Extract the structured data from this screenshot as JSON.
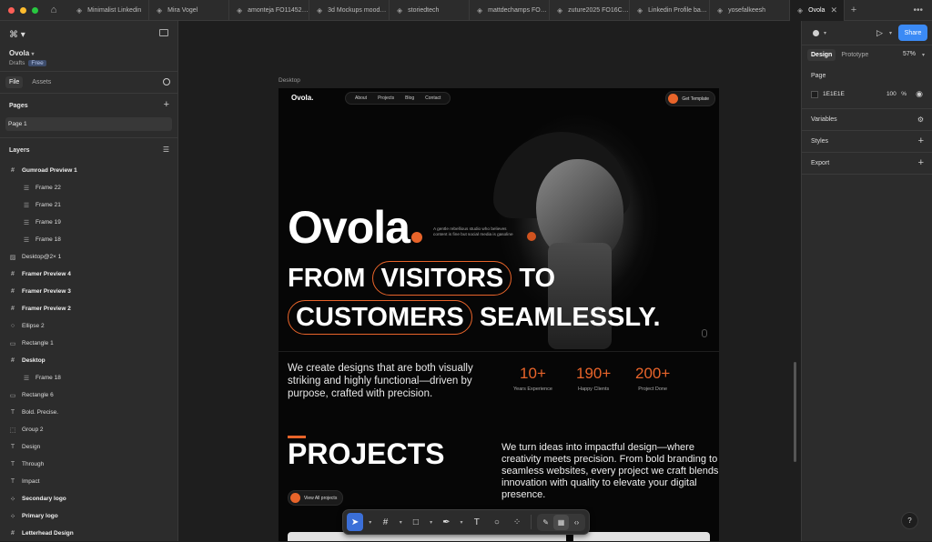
{
  "colors": {
    "accent": "#e8642a",
    "share": "#3b8af5",
    "light_red": "#fe5f57",
    "light_yellow": "#febc2e",
    "light_green": "#28c840"
  },
  "tabs": [
    "Minimalist Linkedin",
    "Mira Vogel",
    "amonteja FO11452…",
    "3d Mockups mood…",
    "storiedtech",
    "mattdechamps FO…",
    "zuture2025 FO16C…",
    "Linkedin Profile ba…",
    "yosefalkeesh",
    "Ovola"
  ],
  "file": {
    "name": "Ovola",
    "location": "Drafts",
    "plan": "Free"
  },
  "left_tabs": {
    "file": "File",
    "assets": "Assets"
  },
  "pages": {
    "title": "Pages",
    "items": [
      "Page 1"
    ]
  },
  "layers": {
    "title": "Layers",
    "items": [
      {
        "label": "Gumroad Preview 1",
        "icon": "frame-icon",
        "bold": true,
        "indent": false
      },
      {
        "label": "Frame 22",
        "icon": "frame-list-icon",
        "bold": false,
        "indent": true
      },
      {
        "label": "Frame 21",
        "icon": "frame-list-icon",
        "bold": false,
        "indent": true
      },
      {
        "label": "Frame 19",
        "icon": "frame-list-icon",
        "bold": false,
        "indent": true
      },
      {
        "label": "Frame 18",
        "icon": "frame-list-icon",
        "bold": false,
        "indent": true
      },
      {
        "label": "Desktop@2× 1",
        "icon": "image-icon",
        "bold": false,
        "indent": false
      },
      {
        "label": "Framer Preview 4",
        "icon": "frame-icon",
        "bold": true,
        "indent": false
      },
      {
        "label": "Framer Preview 3",
        "icon": "frame-icon",
        "bold": true,
        "indent": false
      },
      {
        "label": "Framer Preview 2",
        "icon": "frame-icon",
        "bold": true,
        "indent": false
      },
      {
        "label": "Ellipse 2",
        "icon": "ellipse-icon",
        "bold": false,
        "indent": false
      },
      {
        "label": "Rectangle 1",
        "icon": "rectangle-icon",
        "bold": false,
        "indent": false
      },
      {
        "label": "Desktop",
        "icon": "frame-icon",
        "bold": true,
        "indent": false
      },
      {
        "label": "Frame 18",
        "icon": "frame-list-icon",
        "bold": false,
        "indent": true
      },
      {
        "label": "Rectangle 6",
        "icon": "rectangle-icon",
        "bold": false,
        "indent": false
      },
      {
        "label": "Bold. Precise.",
        "icon": "text-icon",
        "bold": false,
        "indent": false
      },
      {
        "label": "Group 2",
        "icon": "group-icon",
        "bold": false,
        "indent": false
      },
      {
        "label": "Design",
        "icon": "text-icon",
        "bold": false,
        "indent": false
      },
      {
        "label": "Through",
        "icon": "text-icon",
        "bold": false,
        "indent": false
      },
      {
        "label": "Impact",
        "icon": "text-icon",
        "bold": false,
        "indent": false
      },
      {
        "label": "Secondary logo",
        "icon": "component-icon",
        "bold": true,
        "indent": false
      },
      {
        "label": "Primary logo",
        "icon": "component-icon",
        "bold": true,
        "indent": false
      },
      {
        "label": "Letterhead Design",
        "icon": "frame-icon",
        "bold": true,
        "indent": false
      }
    ]
  },
  "canvas": {
    "frame_label": "Desktop"
  },
  "site": {
    "brand": "Ovola.",
    "nav": [
      "About",
      "Projects",
      "Blog",
      "Contact"
    ],
    "cta": "Get Template",
    "hero_brand": "Ovola",
    "tagline": "A gentle rebellious studio who believes content is fine but social media is gasoline",
    "headline": {
      "w1": "FROM",
      "w2": "VISITORS",
      "w3": "TO",
      "w4": "CUSTOMERS",
      "w5": "SEAMLESSLY."
    },
    "intro": "We create designs that are both visually striking and highly functional—driven by purpose, crafted with precision.",
    "stats": [
      {
        "num": "10+",
        "label": "Years Experience"
      },
      {
        "num": "190+",
        "label": "Happy Clients"
      },
      {
        "num": "200+",
        "label": "Project Done"
      }
    ],
    "projects_title": "PROJECTS",
    "projects_desc": "We turn ideas into impactful design—where creativity meets precision. From bold branding to seamless websites, every project we craft blends innovation with quality to elevate your digital presence.",
    "view_all": "View All projects"
  },
  "right": {
    "share": "Share",
    "tabs": {
      "design": "Design",
      "prototype": "Prototype"
    },
    "zoom": "57%",
    "page_title": "Page",
    "page_color": "1E1E1E",
    "page_opacity": "100",
    "page_pct": "%",
    "variables": "Variables",
    "styles": "Styles",
    "export": "Export",
    "help": "?"
  }
}
